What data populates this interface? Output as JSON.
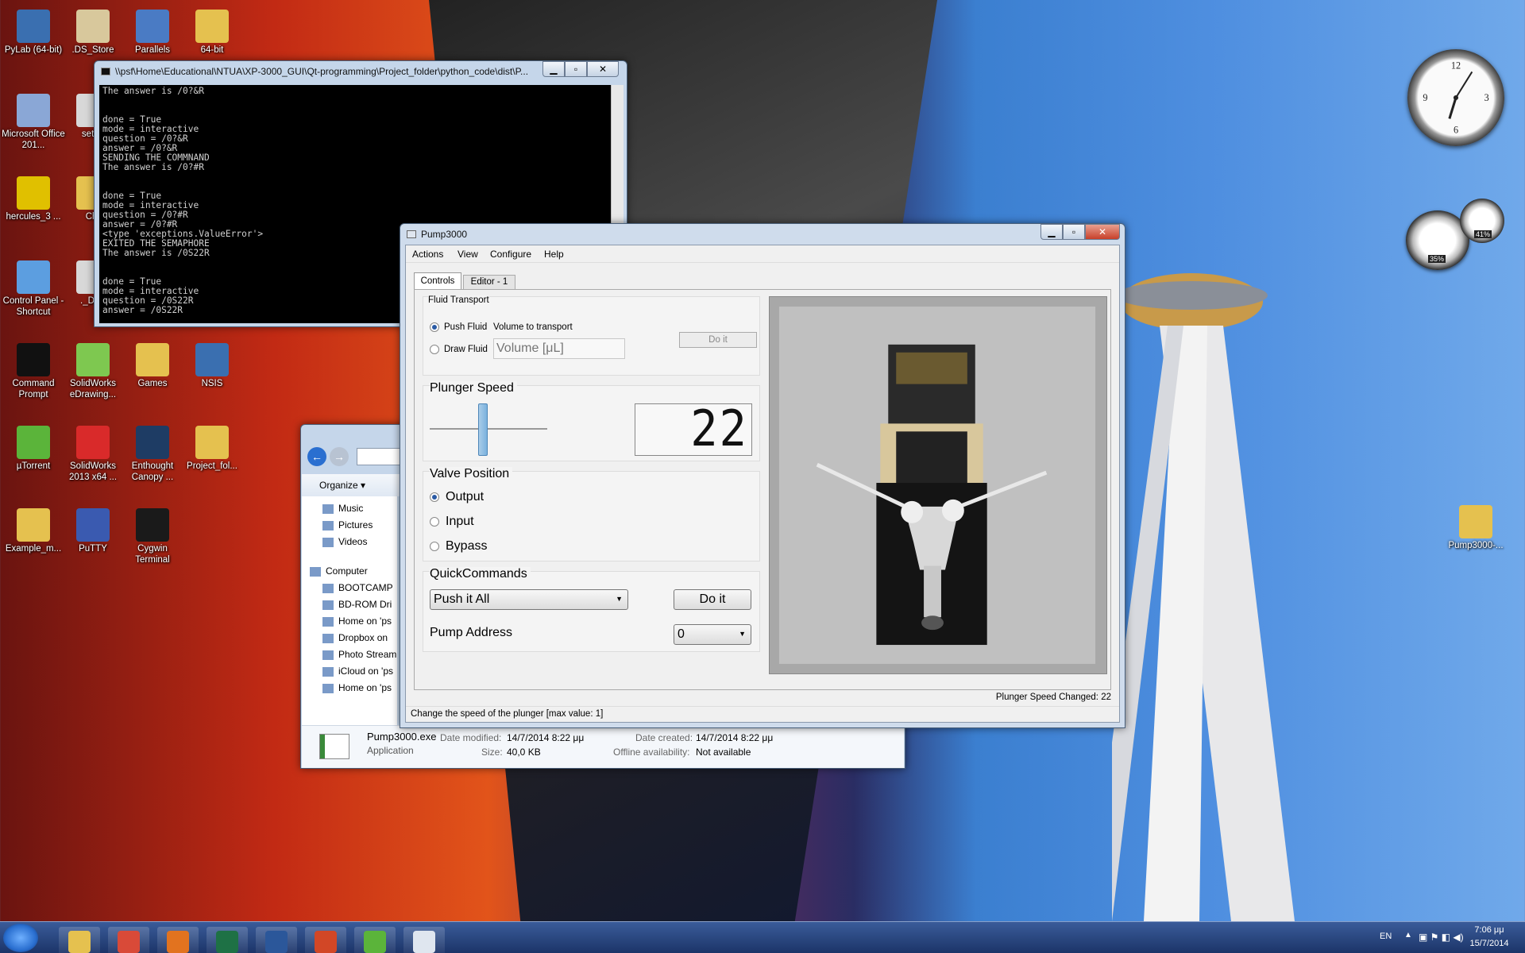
{
  "desktop": {
    "icons": [
      {
        "label": "PyLab (64-bit)",
        "color": "#3a6fb0"
      },
      {
        "label": ".DS_Store",
        "color": "#d8c89c"
      },
      {
        "label": "Parallels",
        "color": "#4a7bc4"
      },
      {
        "label": "64-bit",
        "color": "#e5c14f"
      },
      {
        "label": "Microsoft Office 201...",
        "color": "#8aa7d6"
      },
      {
        "label": "setup",
        "color": "#d8d8d8"
      },
      {
        "label": "hercules_3 ...",
        "color": "#e0c000"
      },
      {
        "label": "Chr",
        "color": "#e5c14f"
      },
      {
        "label": "Control Panel - Shortcut",
        "color": "#5c9ee0"
      },
      {
        "label": "._DS_",
        "color": "#d8d8d8"
      },
      {
        "label": "Command Prompt",
        "color": "#111111"
      },
      {
        "label": "SolidWorks eDrawing...",
        "color": "#7ec850"
      },
      {
        "label": "Games",
        "color": "#e5c14f"
      },
      {
        "label": "NSIS",
        "color": "#3a6fb0"
      },
      {
        "label": "µTorrent",
        "color": "#5bb43a"
      },
      {
        "label": "SolidWorks 2013 x64 ...",
        "color": "#d92a2a"
      },
      {
        "label": "Enthought Canopy ...",
        "color": "#1e3c64"
      },
      {
        "label": "Project_fol...",
        "color": "#e5c14f"
      },
      {
        "label": "Example_m...",
        "color": "#e5c14f"
      },
      {
        "label": "PuTTY",
        "color": "#3a5ab0"
      },
      {
        "label": "Cygwin Terminal",
        "color": "#1a1a1a"
      },
      {
        "label": "Pump3000-...",
        "color": "#e5c14f"
      }
    ]
  },
  "console": {
    "title": "\\\\psf\\Home\\Educational\\NTUA\\XP-3000_GUI\\Qt-programming\\Project_folder\\python_code\\dist\\P...",
    "text": "The answer is /0?&R\n\n\ndone = True\nmode = interactive\nquestion = /0?&R\nanswer = /0?&R\nSENDING THE COMMNAND\nThe answer is /0?#R\n\n\ndone = True\nmode = interactive\nquestion = /0?#R\nanswer = /0?#R\n<type 'exceptions.ValueError'>\nEXITED THE SEMAPHORE\nThe answer is /0S22R\n\n\ndone = True\nmode = interactive\nquestion = /0S22R\nanswer = /0S22R"
  },
  "explorer": {
    "organize": "Organize ▾",
    "nav": [
      "Music",
      "Pictures",
      "Videos",
      "Computer",
      "BOOTCAMP",
      "BD-ROM Dri",
      "Home on 'ps",
      "Dropbox on",
      "Photo Stream",
      "iCloud on 'ps",
      "Home on 'ps"
    ],
    "file": {
      "name": "Pump3000.exe",
      "date_mod_label": "Date modified:",
      "date_mod": "14/7/2014 8:22 μμ",
      "date_cr_label": "Date created:",
      "date_cr": "14/7/2014 8:22 μμ",
      "type": "Application",
      "size_label": "Size:",
      "size": "40,0 KB",
      "offline_label": "Offline availability:",
      "offline": "Not available"
    }
  },
  "pump": {
    "title": "Pump3000",
    "menu": [
      "Actions",
      "View",
      "Configure",
      "Help"
    ],
    "tabs": [
      "Controls",
      "Editor - 1"
    ],
    "fluid": {
      "title": "Fluid Transport",
      "push": "Push Fluid",
      "draw": "Draw Fluid",
      "volume_label": "Volume to transport",
      "volume_placeholder": "Volume [μL]",
      "do_it": "Do it"
    },
    "plunger": {
      "title": "Plunger Speed",
      "value": "22",
      "slider_fraction": 0.45
    },
    "valve": {
      "title": "Valve Position",
      "options": [
        "Output",
        "Input",
        "Bypass"
      ],
      "selected": "Output"
    },
    "quick": {
      "title": "QuickCommands",
      "command": "Push it All",
      "do_it": "Do it",
      "address_label": "Pump Address",
      "address": "0"
    },
    "status_right": "Plunger Speed Changed: 22",
    "status_left": "Change the speed of the plunger [max value: 1]"
  },
  "taskbar": {
    "lang": "EN",
    "time": "7:06 μμ",
    "date": "15/7/2014",
    "apps": [
      {
        "name": "start-button",
        "color": "#2a6fd0"
      },
      {
        "name": "explorer",
        "color": "#e5c14f"
      },
      {
        "name": "chrome",
        "color": "#d94a38"
      },
      {
        "name": "firefox",
        "color": "#e2731f"
      },
      {
        "name": "excel",
        "color": "#1e7145"
      },
      {
        "name": "word",
        "color": "#2b579a"
      },
      {
        "name": "powerpoint",
        "color": "#d24726"
      },
      {
        "name": "utorrent",
        "color": "#5bb43a"
      },
      {
        "name": "pump3000",
        "color": "#dfe6ef"
      }
    ]
  },
  "gadgets": {
    "clock": "clock",
    "cpu_label": "35%",
    "mem_label": "41%"
  }
}
